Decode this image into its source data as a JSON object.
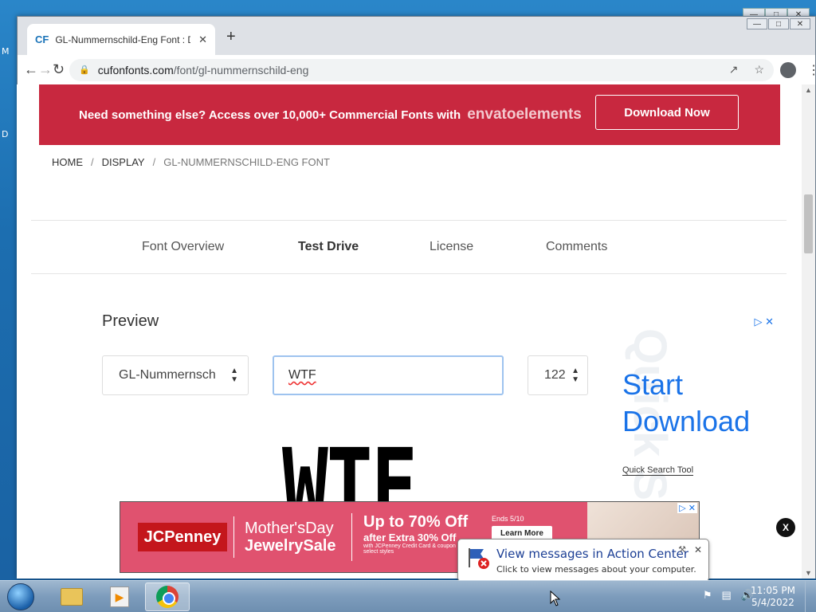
{
  "desktop": {
    "label_left_1": "M",
    "label_left_2": "D"
  },
  "background_window": {
    "controls": [
      "—",
      "□",
      "✕"
    ]
  },
  "browser": {
    "tab": {
      "favicon": "CF",
      "title": "GL-Nummernschild-Eng Font : D",
      "close": "✕"
    },
    "new_tab": "+",
    "window_controls": [
      "—",
      "□",
      "✕"
    ],
    "url_host": "cufonfonts.com",
    "url_path": "/font/gl-nummernschild-eng",
    "icons": [
      "back-icon",
      "forward-icon",
      "reload-icon",
      "lock-icon",
      "share-icon",
      "star-icon",
      "profile-icon",
      "menu-icon"
    ]
  },
  "promo": {
    "text": "Need something else? Access over 10,000+ Commercial Fonts with",
    "brand": "envatoelements",
    "button": "Download Now",
    "color": "#c8283f"
  },
  "breadcrumb": [
    "HOME",
    "DISPLAY",
    "GL-NUMMERNSCHILD-ENG FONT"
  ],
  "page_tabs": [
    "Font Overview",
    "Test Drive",
    "License",
    "Comments"
  ],
  "preview": {
    "title": "Preview",
    "font_select": "GL-Nummernsch",
    "text_value": "WTF",
    "size_select": "122",
    "render_text": "WTF"
  },
  "side_ad": {
    "headline_1": "Start",
    "headline_2": "Download",
    "link": "Quick Search Tool",
    "ghost": "Quick Search"
  },
  "close_button": "X",
  "jc_ad": {
    "logo": "JCPenney",
    "event_1": "Mother'sDay",
    "event_2": "JewelrySale",
    "offer_big": "Up to 70% Off",
    "offer_mid": "after Extra 30% Off",
    "offer_small": "with JCPenney Credit Card & coupon on select styles",
    "ends": "Ends 5/10",
    "learn_more": "Learn More"
  },
  "balloon": {
    "title": "View messages in Action Center",
    "subtitle": "Click to view messages about your computer.",
    "close": "✕"
  },
  "taskbar": {
    "time": "11:05 PM",
    "date": "5/4/2022"
  }
}
